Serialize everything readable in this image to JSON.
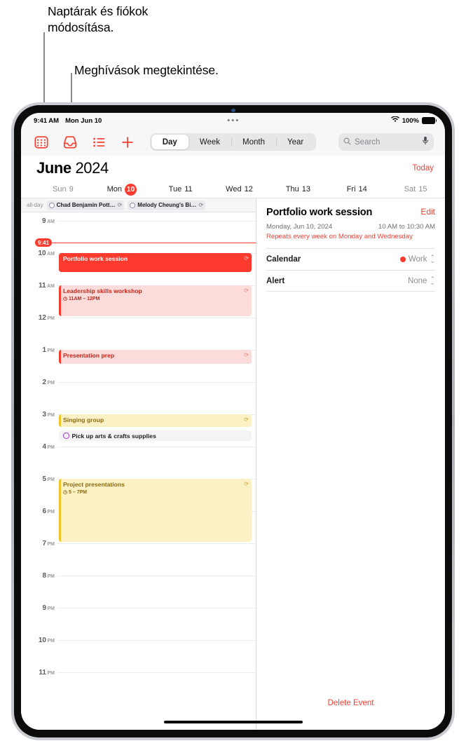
{
  "callouts": [
    {
      "text": "Naptárak és fiókok\nmódosítása.",
      "target": "calendars-icon"
    },
    {
      "text": "Meghívások megtekintése.",
      "target": "inbox-icon"
    }
  ],
  "statusbar": {
    "time": "9:41 AM",
    "date": "Mon Jun 10",
    "wifi_icon": "wifi-icon",
    "battery_percent": "100%",
    "battery_icon": "battery-full-icon"
  },
  "toolbar": {
    "icons": [
      {
        "name": "calendars-icon",
        "label": "Calendars"
      },
      {
        "name": "inbox-icon",
        "label": "Inbox"
      },
      {
        "name": "list-icon",
        "label": "List"
      },
      {
        "name": "add-icon",
        "label": "Add Event"
      }
    ],
    "ellipsis": "more-options-icon",
    "segments": [
      {
        "label": "Day",
        "active": true
      },
      {
        "label": "Week",
        "active": false
      },
      {
        "label": "Month",
        "active": false
      },
      {
        "label": "Year",
        "active": false
      }
    ],
    "search": {
      "placeholder": "Search",
      "search_icon": "search-icon",
      "mic_icon": "microphone-icon"
    }
  },
  "month_header": {
    "month": "June",
    "year": "2024",
    "today_label": "Today"
  },
  "weekdays": [
    {
      "name": "Sun",
      "num": "9",
      "today": false,
      "weekend": true
    },
    {
      "name": "Mon",
      "num": "10",
      "today": true,
      "weekend": false
    },
    {
      "name": "Tue",
      "num": "11",
      "today": false,
      "weekend": false
    },
    {
      "name": "Wed",
      "num": "12",
      "today": false,
      "weekend": false
    },
    {
      "name": "Thu",
      "num": "13",
      "today": false,
      "weekend": false
    },
    {
      "name": "Fri",
      "num": "14",
      "today": false,
      "weekend": false
    },
    {
      "name": "Sat",
      "num": "15",
      "today": false,
      "weekend": true
    }
  ],
  "allday": {
    "label": "all-day",
    "events": [
      {
        "title": "Chad Benjamin Pott…",
        "repeat": true
      },
      {
        "title": "Melody Cheung's Bi…",
        "repeat": true
      }
    ]
  },
  "timeline": {
    "hours": [
      {
        "num": "9",
        "suffix": "AM"
      },
      {
        "num": "10",
        "suffix": "AM"
      },
      {
        "num": "11",
        "suffix": "AM"
      },
      {
        "num": "12",
        "suffix": "PM"
      },
      {
        "num": "1",
        "suffix": "PM"
      },
      {
        "num": "2",
        "suffix": "PM"
      },
      {
        "num": "3",
        "suffix": "PM"
      },
      {
        "num": "4",
        "suffix": "PM"
      },
      {
        "num": "5",
        "suffix": "PM"
      },
      {
        "num": "6",
        "suffix": "PM"
      },
      {
        "num": "7",
        "suffix": "PM"
      },
      {
        "num": "8",
        "suffix": "PM"
      },
      {
        "num": "9",
        "suffix": "PM"
      },
      {
        "num": "10",
        "suffix": "PM"
      },
      {
        "num": "11",
        "suffix": "PM"
      }
    ],
    "now": {
      "label": "9:41",
      "hour_offset": 0.68
    },
    "events": [
      {
        "title": "Portfolio work session",
        "time": "",
        "style": "solid",
        "start": 1.0,
        "duration": 0.62,
        "repeat": true
      },
      {
        "title": "Leadership skills workshop",
        "time": "11AM – 12PM",
        "style": "pink",
        "start": 2.0,
        "duration": 1.0,
        "repeat": true
      },
      {
        "title": "Presentation prep",
        "time": "",
        "style": "pink",
        "start": 4.0,
        "duration": 0.48,
        "repeat": true
      },
      {
        "title": "Singing group",
        "time": "",
        "style": "yellow",
        "start": 6.0,
        "duration": 0.44,
        "repeat": true
      },
      {
        "title": "Project presentations",
        "time": "5 – 7PM",
        "style": "yellow",
        "start": 8.0,
        "duration": 2.0,
        "repeat": true
      }
    ],
    "reminders": [
      {
        "title": "Pick up arts & crafts supplies",
        "start": 6.5
      }
    ]
  },
  "detail": {
    "title": "Portfolio work session",
    "edit_label": "Edit",
    "date": "Monday, Jun 10, 2024",
    "time": "10 AM to 10:30 AM",
    "repeat": "Repeats every week on Monday and Wednesday",
    "rows": [
      {
        "label": "Calendar",
        "value": "Work",
        "dot_color": "#fc3b2e",
        "stepper": true
      },
      {
        "label": "Alert",
        "value": "None",
        "dot_color": "",
        "stepper": true
      }
    ],
    "delete_label": "Delete Event"
  }
}
